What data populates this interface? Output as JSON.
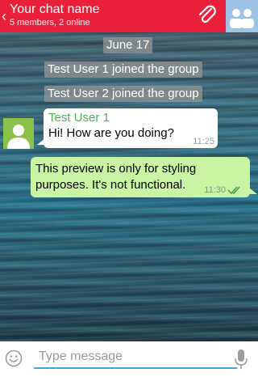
{
  "header": {
    "chat_name": "Your chat name",
    "subtitle": "5 members, 2 online"
  },
  "messages": {
    "date_separator": "June 17",
    "system": [
      "Test User 1 joined the group",
      "Test User 2 joined the group"
    ],
    "incoming": {
      "sender": "Test User 1",
      "text": "Hi! How are you doing?",
      "time": "11:25"
    },
    "outgoing": {
      "text": "This preview is only for styling purposes. It's not functional.",
      "time": "11:30"
    }
  },
  "composer": {
    "placeholder": "Type message"
  },
  "colors": {
    "header": "#ea1f3a",
    "accent": "#3da9d8",
    "sender_name": "#4caf50",
    "outgoing_bubble": "#c8f4a4",
    "group_avatar": "#9ec3e7",
    "user_avatar": "#8bc34a"
  },
  "icons": [
    "back-chevron-icon",
    "paperclip-icon",
    "group-icon",
    "user-icon",
    "double-check-icon",
    "emoji-icon",
    "microphone-icon"
  ]
}
